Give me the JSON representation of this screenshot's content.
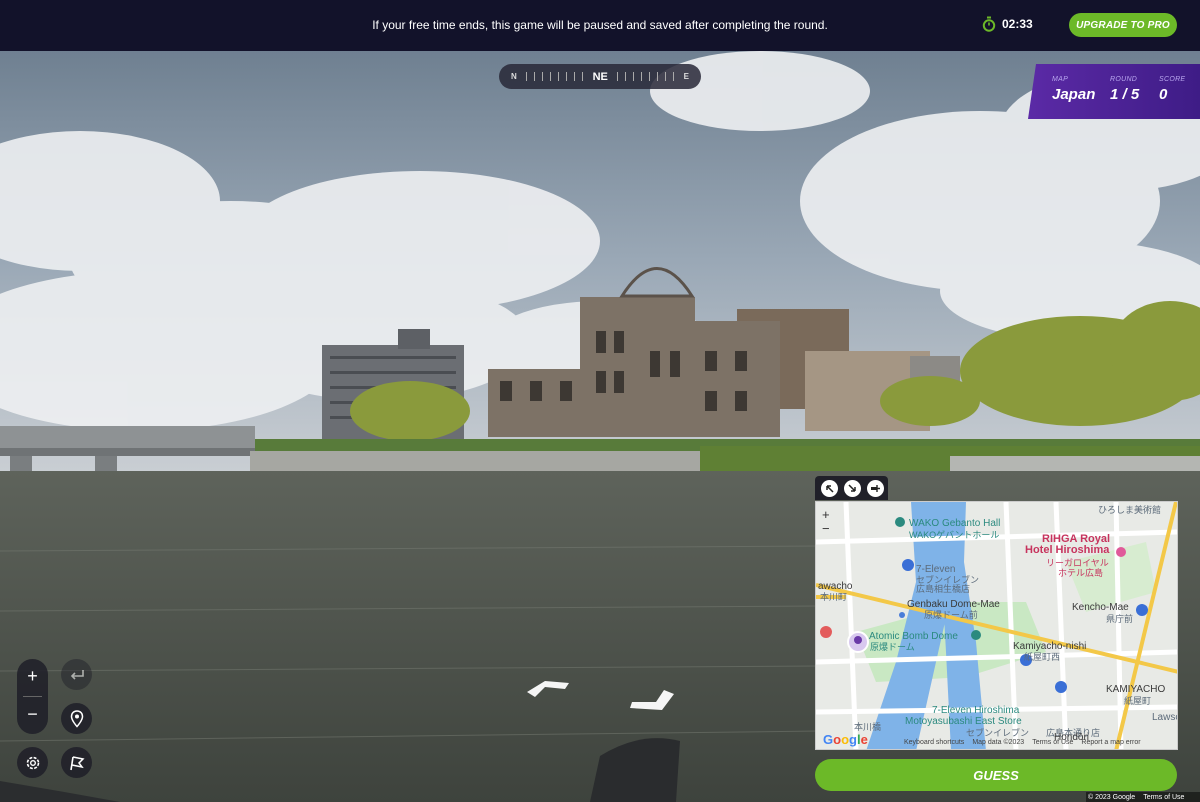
{
  "topbar": {
    "notice": "If your free time ends, this game will be paused and saved after completing the round.",
    "timer": "02:33",
    "upgrade_label": "UPGRADE TO PRO",
    "timer_icon": "stopwatch-icon"
  },
  "compass": {
    "left": "N",
    "center": "NE",
    "right": "E"
  },
  "status": {
    "map_label": "MAP",
    "map_value": "Japan",
    "round_label": "ROUND",
    "round_value": "1 / 5",
    "score_label": "SCORE",
    "score_value": "0"
  },
  "controls": {
    "zoom_in": "+",
    "zoom_out": "−",
    "icons": [
      "plus-icon",
      "minus-icon",
      "undo-arrow-icon",
      "location-pin-icon",
      "settings-gear-icon",
      "flag-icon"
    ]
  },
  "minimap": {
    "tools": [
      "expand-icon",
      "shrink-icon",
      "pin-icon"
    ],
    "zoom_in": "+",
    "zoom_out": "−",
    "labels": {
      "wako": "WAKO Gebanto Hall",
      "wako_jp": "WAKOゲバントホール",
      "rihga1": "RIHGA Royal",
      "rihga2": "Hotel Hiroshima",
      "rihga_jp1": "リーガロイヤル",
      "rihga_jp2": "ホテル広島",
      "museum_jp": "ひろしま美術館",
      "seven1": "7-Eleven",
      "seven1_jp1": "セブンイレブン",
      "seven1_jp2": "広島相生橋店",
      "awacho": "awacho",
      "awacho_jp": "本川町",
      "genbaku": "Genbaku Dome-Mae",
      "genbaku_jp": "原爆ドーム前",
      "kencho": "Kencho-Mae",
      "kencho_jp": "県庁前",
      "dome": "Atomic Bomb Dome",
      "dome_jp": "原爆ドーム",
      "kamiyacho": "Kamiyacho-nishi",
      "kamiyacho_jp": "紙屋町西",
      "kamiyacho2": "KAMIYACHO",
      "kamiyacho2_jp": "紙屋町",
      "seven2a": "7-Eleven Hiroshima",
      "seven2b": "Motoyasubashi East Store",
      "seven2_jp1": "セブンイレブン",
      "seven2_jp2": "広島本通り店",
      "lawson": "Lawso",
      "hondori": "Hondōri",
      "hongawa_jp": "本川橋"
    },
    "footer": [
      "Keyboard shortcuts",
      "Map data ©2023",
      "Terms of Use",
      "Report a map error"
    ],
    "google": "Google",
    "colors": {
      "river": "#7fb3e8",
      "rail": "#f3c848",
      "park": "#c9e8c3",
      "road": "#ffffff"
    }
  },
  "guess_label": "GUESS",
  "copyright": {
    "text": "© 2023 Google",
    "terms": "Terms of Use"
  },
  "colors": {
    "accent_green": "#6cb928",
    "status_purple": "#5b2aa6",
    "topbar_bg": "#12122a"
  }
}
